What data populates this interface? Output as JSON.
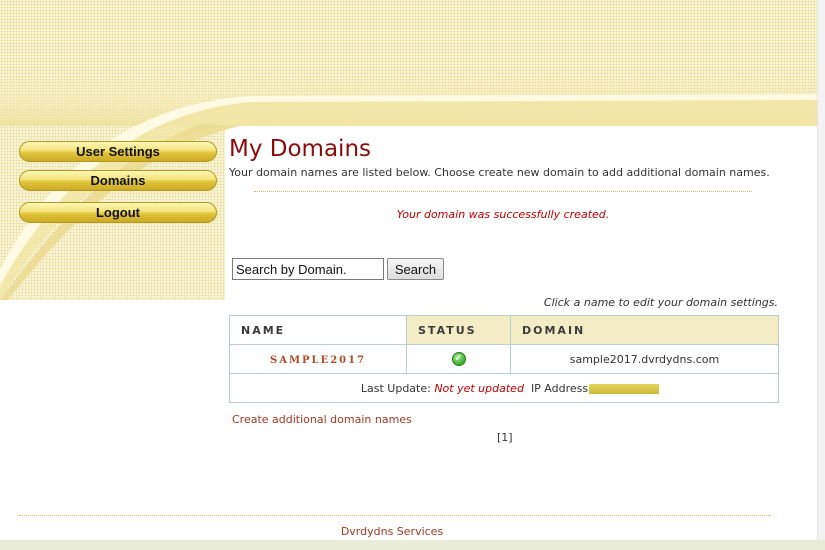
{
  "sidebar": {
    "items": [
      {
        "label": "User Settings"
      },
      {
        "label": "Domains"
      },
      {
        "label": "Logout"
      }
    ]
  },
  "main": {
    "title": "My Domains",
    "intro": "Your domain names are listed below. Choose create new domain to add additional domain names.",
    "success_message": "Your domain was successfully created.",
    "search": {
      "value": "Search by Domain.",
      "button_label": "Search"
    },
    "hint": "Click a name to edit your domain settings.",
    "table": {
      "headers": [
        "NAME",
        "STATUS",
        "DOMAIN"
      ],
      "rows": [
        {
          "name": "SAMPLE2017",
          "status_icon": "check-circle-icon",
          "domain": "sample2017.dvrdydns.com",
          "last_update_label": "Last Update:",
          "last_update_value": "Not yet updated",
          "ip_label": "IP Address"
        }
      ]
    },
    "create_link": "Create additional domain names",
    "pager": "[1]"
  },
  "footer": {
    "text": "Dvrdydns Services"
  },
  "colors": {
    "title": "#8b0b0b",
    "link": "#a33a20",
    "alert": "#c00000",
    "header_bg": "#fbf6d6",
    "button_gold": "#e1c63c",
    "table_border": "#b9cfcf"
  }
}
